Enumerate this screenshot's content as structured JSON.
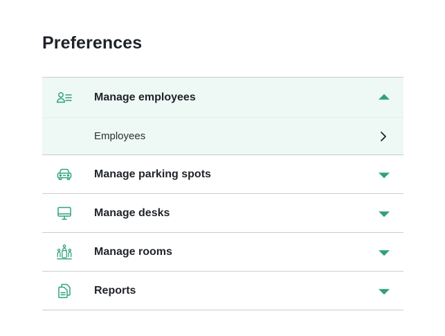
{
  "page": {
    "title": "Preferences"
  },
  "menu": {
    "items": [
      {
        "label": "Manage employees",
        "icon": "user-list-icon",
        "expanded": true,
        "subitems": [
          {
            "label": "Employees"
          }
        ]
      },
      {
        "label": "Manage parking spots",
        "icon": "car-icon",
        "expanded": false
      },
      {
        "label": "Manage desks",
        "icon": "desk-monitor-icon",
        "expanded": false
      },
      {
        "label": "Manage rooms",
        "icon": "meeting-room-icon",
        "expanded": false
      },
      {
        "label": "Reports",
        "icon": "documents-icon",
        "expanded": false
      }
    ]
  },
  "colors": {
    "accent": "#2ea375",
    "expanded_bg": "#eef8f4",
    "divider": "#c8ccd0",
    "text": "#1f2328"
  }
}
